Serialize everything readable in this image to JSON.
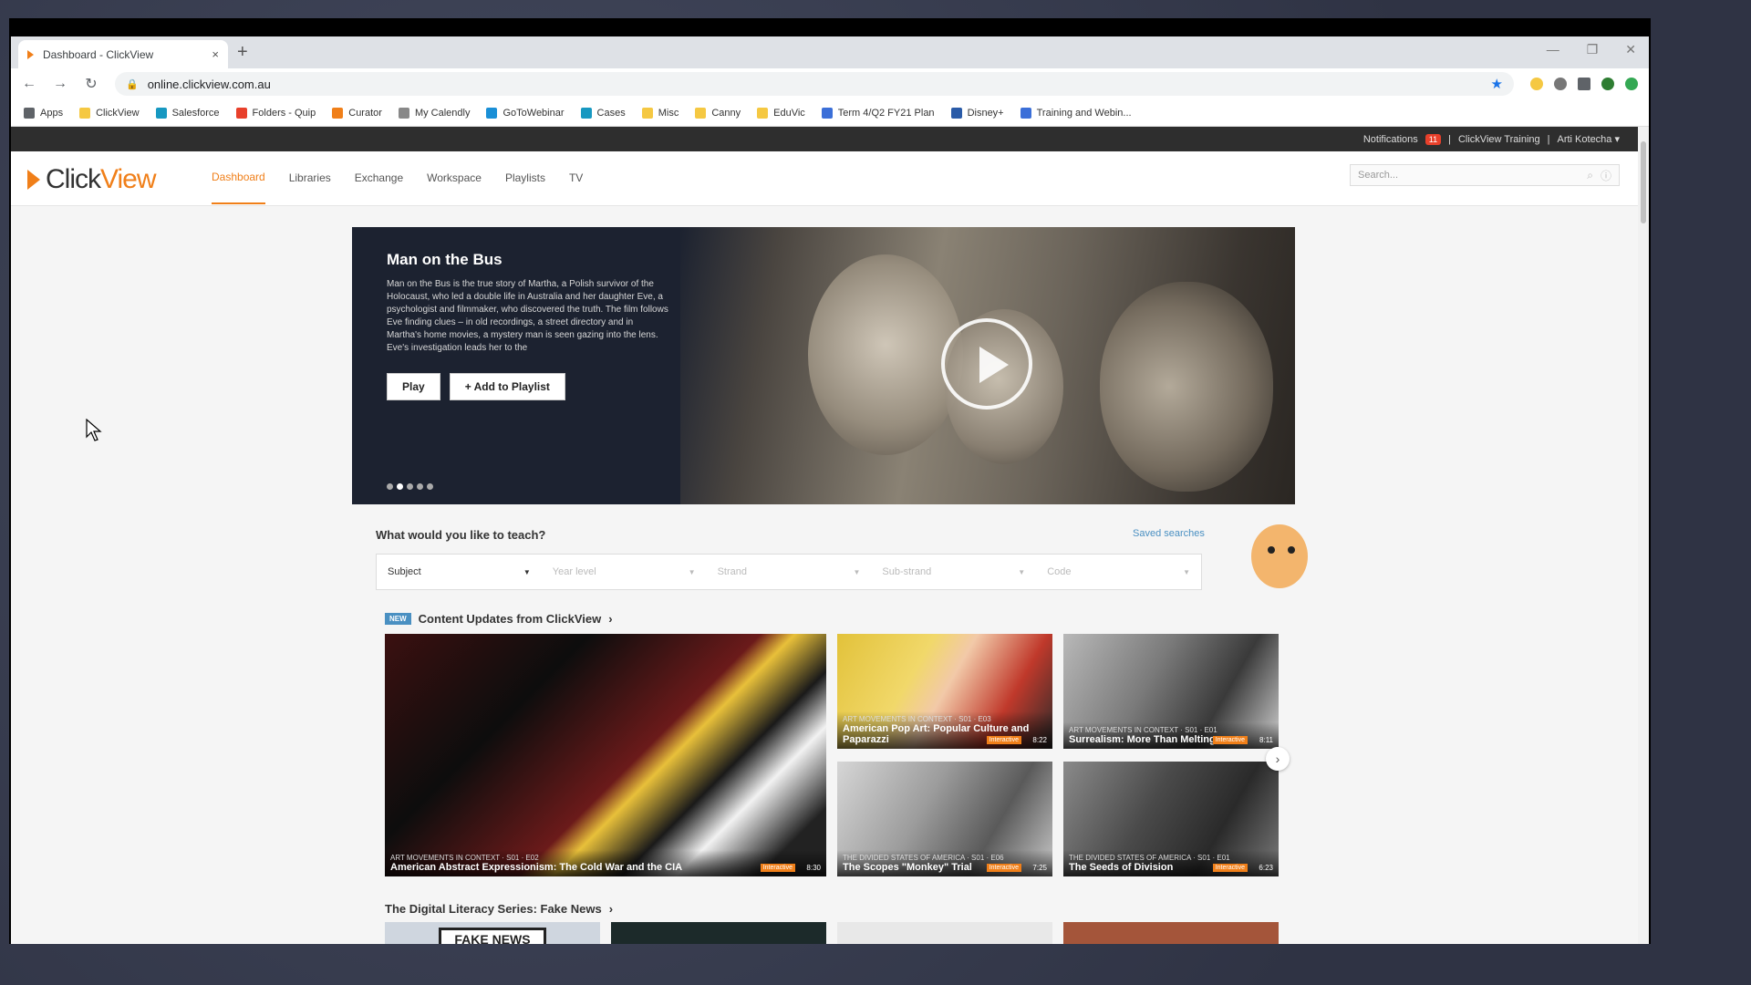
{
  "browser": {
    "tab_title": "Dashboard - ClickView",
    "tab_close": "×",
    "new_tab": "+",
    "url": "online.clickview.com.au",
    "window_controls": [
      "—",
      "❐",
      "✕"
    ],
    "bookmarks": [
      {
        "label": "Apps",
        "color": "#5f6368"
      },
      {
        "label": "ClickView",
        "color": "#f5c842"
      },
      {
        "label": "Salesforce",
        "color": "#1798c1"
      },
      {
        "label": "Folders - Quip",
        "color": "#e8402b"
      },
      {
        "label": "Curator",
        "color": "#f07f19"
      },
      {
        "label": "My Calendly",
        "color": "#888888"
      },
      {
        "label": "GoToWebinar",
        "color": "#1a8fd6"
      },
      {
        "label": "Cases",
        "color": "#1798c1"
      },
      {
        "label": "Misc",
        "color": "#f5c842"
      },
      {
        "label": "Canny",
        "color": "#f5c842"
      },
      {
        "label": "EduVic",
        "color": "#f5c842"
      },
      {
        "label": "Term 4/Q2 FY21 Plan",
        "color": "#3b6fd8"
      },
      {
        "label": "Disney+",
        "color": "#2a5ba8"
      },
      {
        "label": "Training and Webin...",
        "color": "#3b6fd8"
      }
    ]
  },
  "topbar": {
    "notifications": "Notifications",
    "notif_count": "11",
    "sep": "|",
    "org": "ClickView Training",
    "user": "Arti Kotecha ▾"
  },
  "logo": {
    "click": "Click",
    "view": "View"
  },
  "nav": [
    "Dashboard",
    "Libraries",
    "Exchange",
    "Workspace",
    "Playlists",
    "TV"
  ],
  "search": {
    "placeholder": "Search..."
  },
  "hero": {
    "title": "Man on the Bus",
    "description": "Man on the Bus is the true story of Martha, a Polish survivor of the Holocaust, who led a double life in Australia and her daughter Eve, a psychologist and filmmaker, who discovered the truth. The film follows Eve finding clues – in old recordings, a street directory and in Martha's home movies, a mystery man is seen gazing into the lens. Eve's investigation leads her to the",
    "play_label": "Play",
    "playlist_label": "+ Add to Playlist",
    "dots": 5,
    "active_dot": 1
  },
  "teach": {
    "title": "What would you like to teach?",
    "saved": "Saved searches",
    "filters": [
      "Subject",
      "Year level",
      "Strand",
      "Sub-strand",
      "Code"
    ]
  },
  "content_updates": {
    "badge": "NEW",
    "title": "Content Updates from ClickView",
    "chevron": "›",
    "cards": [
      {
        "series": "ART MOVEMENTS IN CONTEXT · S01 · E02",
        "title": "American Abstract Expressionism: The Cold War and the CIA",
        "duration": "8:30",
        "tag": "Interactive"
      },
      {
        "series": "ART MOVEMENTS IN CONTEXT · S01 · E03",
        "title": "American Pop Art: Popular Culture and Paparazzi",
        "duration": "8:22",
        "tag": "Interactive"
      },
      {
        "series": "ART MOVEMENTS IN CONTEXT · S01 · E01",
        "title": "Surrealism: More Than Melting",
        "duration": "8:11",
        "tag": "Interactive"
      },
      {
        "series": "THE DIVIDED STATES OF AMERICA · S01 · E06",
        "title": "The Scopes \"Monkey\" Trial",
        "duration": "7:25",
        "tag": "Interactive"
      },
      {
        "series": "THE DIVIDED STATES OF AMERICA · S01 · E01",
        "title": "The Seeds of Division",
        "duration": "6:23",
        "tag": "Interactive"
      }
    ]
  },
  "digital_literacy": {
    "title": "The Digital Literacy Series: Fake News",
    "chevron": "›",
    "first_thumb_text": "FAKE NEWS"
  }
}
